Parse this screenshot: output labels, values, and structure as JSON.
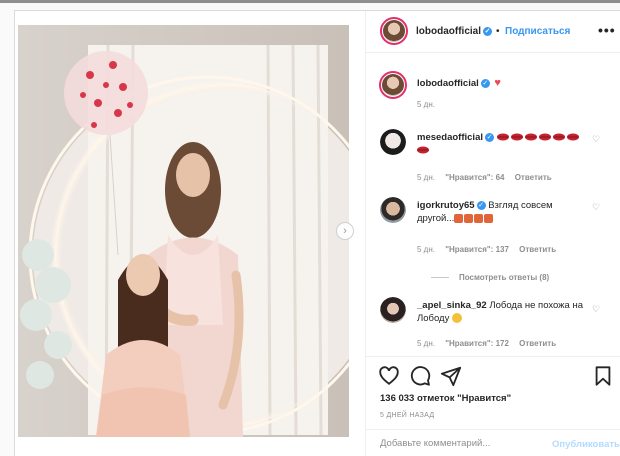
{
  "post": {
    "username": "lobodaofficial",
    "follow_label": "Подписаться",
    "dot": "•",
    "more": "•••",
    "next_arrow": "›"
  },
  "caption": {
    "username": "lobodaofficial",
    "time": "5 дн."
  },
  "comments": [
    {
      "username": "mesedaofficial",
      "text": "",
      "time": "5 дн.",
      "likes": "\"Нравится\": 64",
      "reply": "Ответить"
    },
    {
      "username": "igorkrutoy65",
      "text": "Взгляд совсем другой...",
      "time": "5 дн.",
      "likes": "\"Нравится\": 137",
      "reply": "Ответить"
    },
    {
      "username": "_apel_sinka_92",
      "text": "Лобода не похожа на Лободу",
      "time": "5 дн.",
      "likes": "\"Нравится\": 172",
      "reply": "Ответить"
    }
  ],
  "view_replies": "Посмотреть ответы (8)",
  "likes_text": "136 033 отметок \"Нравится\"",
  "date_text": "5 ДНЕЙ НАЗАД",
  "add_comment": {
    "placeholder": "Добавьте комментарий...",
    "post_label": "Опубликовать"
  },
  "colors": {
    "accent": "#3897f0",
    "story_ring": "#e1306c",
    "heart_red": "#ed4956"
  },
  "icons": {
    "verified": "verified-badge-icon",
    "like": "heart-icon",
    "comment": "comment-bubble-icon",
    "share": "paper-plane-icon",
    "save": "bookmark-icon"
  }
}
